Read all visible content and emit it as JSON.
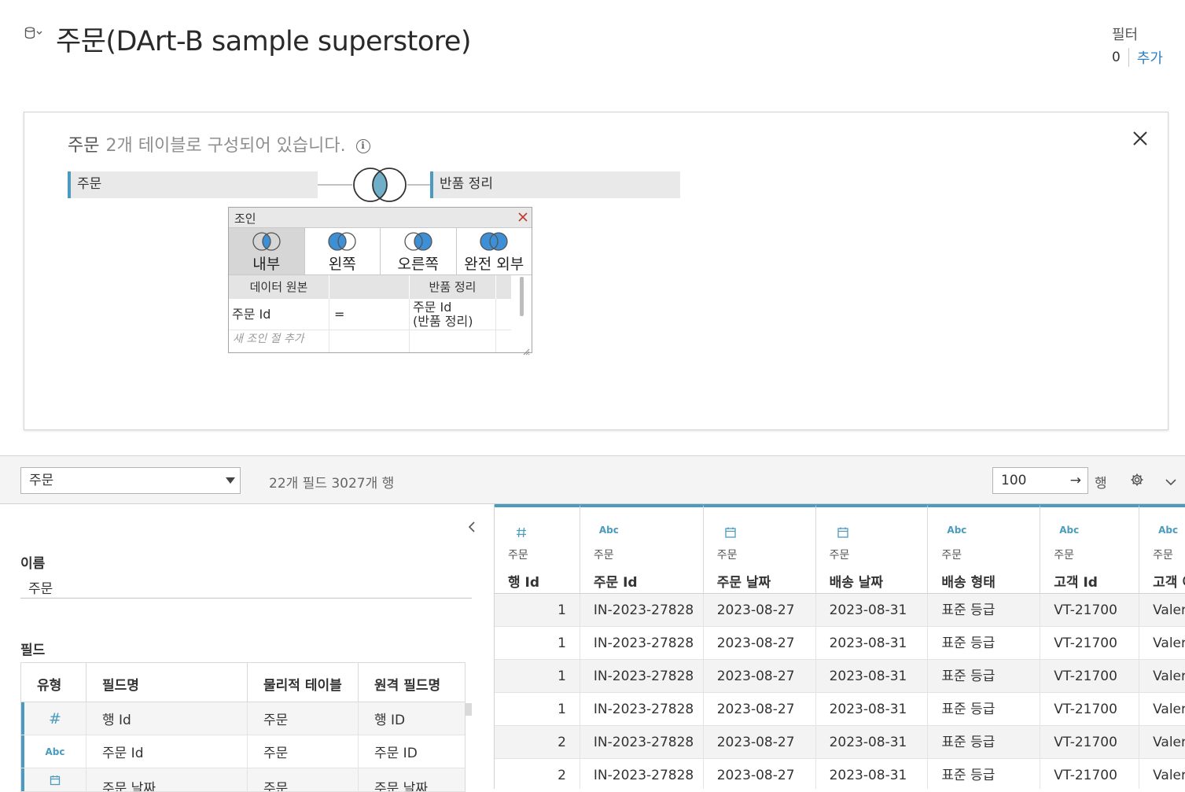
{
  "header": {
    "title": "주문(DArt-B sample superstore)",
    "filter_label": "필터",
    "filter_count": "0",
    "filter_add": "추가"
  },
  "join_panel": {
    "table_name": "주문",
    "description": "2개 테이블로 구성되어 있습니다.",
    "left_table": "주문",
    "right_table": "반품 정리"
  },
  "join_dialog": {
    "title": "조인",
    "types": [
      "내부",
      "왼쪽",
      "오른쪽",
      "완전 외부"
    ],
    "selected_type": "내부",
    "clause_headers": [
      "데이터 원본",
      "",
      "반품 정리"
    ],
    "clause": {
      "left": "주문 Id",
      "op": "=",
      "right": "주문 Id\n(반품 정리)"
    },
    "new_clause": "새 조인 절 추가"
  },
  "toolbar": {
    "table_select": "주문",
    "summary": "22개 필드 3027개 행",
    "rows_value": "100",
    "rows_unit": "행"
  },
  "metadata": {
    "name_label": "이름",
    "name_value": "주문",
    "fields_label": "필드",
    "columns": [
      "유형",
      "필드명",
      "물리적 테이블",
      "원격 필드명"
    ],
    "rows": [
      {
        "type": "#",
        "name": "행 Id",
        "table": "주문",
        "remote": "행 ID"
      },
      {
        "type": "Abc",
        "name": "주문 Id",
        "table": "주문",
        "remote": "주문 ID"
      },
      {
        "type": "date",
        "name": "주문 날짜",
        "table": "주문",
        "remote": "주문 날짜"
      }
    ]
  },
  "grid": {
    "columns": [
      {
        "type": "#",
        "source": "주문",
        "name": "행 Id"
      },
      {
        "type": "Abc",
        "source": "주문",
        "name": "주문 Id"
      },
      {
        "type": "date",
        "source": "주문",
        "name": "주문 날짜"
      },
      {
        "type": "date",
        "source": "주문",
        "name": "배송 날짜"
      },
      {
        "type": "Abc",
        "source": "주문",
        "name": "배송 형태"
      },
      {
        "type": "Abc",
        "source": "주문",
        "name": "고객 Id"
      },
      {
        "type": "Abc",
        "source": "주문",
        "name": "고객 이름"
      }
    ],
    "rows": [
      [
        "1",
        "IN-2023-27828",
        "2023-08-27",
        "2023-08-31",
        "표준 등급",
        "VT-21700",
        "Valerie Takahito"
      ],
      [
        "1",
        "IN-2023-27828",
        "2023-08-27",
        "2023-08-31",
        "표준 등급",
        "VT-21700",
        "Valerie Takahito"
      ],
      [
        "1",
        "IN-2023-27828",
        "2023-08-27",
        "2023-08-31",
        "표준 등급",
        "VT-21700",
        "Valerie Takahito"
      ],
      [
        "1",
        "IN-2023-27828",
        "2023-08-27",
        "2023-08-31",
        "표준 등급",
        "VT-21700",
        "Valerie Takahito"
      ],
      [
        "2",
        "IN-2023-27828",
        "2023-08-27",
        "2023-08-31",
        "표준 등급",
        "VT-21700",
        "Valerie Takahito"
      ],
      [
        "2",
        "IN-2023-27828",
        "2023-08-27",
        "2023-08-31",
        "표준 등급",
        "VT-21700",
        "Valerie Takahito"
      ]
    ]
  },
  "colors": {
    "accent": "#4a9bbd",
    "venn_blue": "#3d8fd6",
    "link": "#2f7fc1"
  },
  "icons": {
    "db": "database-icon",
    "info": "info-icon",
    "close": "close-icon",
    "gear": "gear-icon",
    "chevron": "chevron-down-icon"
  }
}
